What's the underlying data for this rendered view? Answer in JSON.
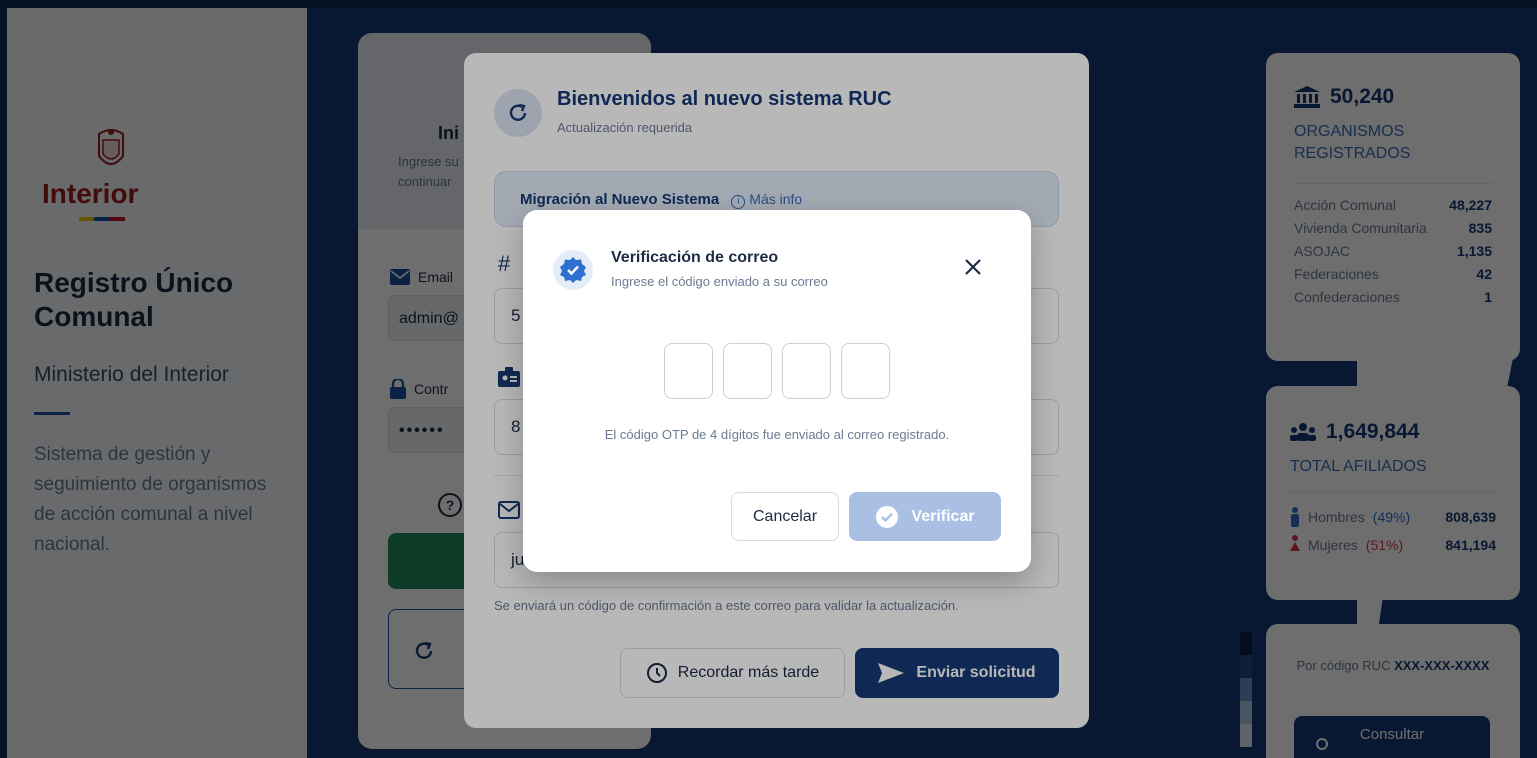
{
  "brand": {
    "name": "Interior",
    "flag_colors": [
      "#f2c200",
      "#1c4ea0",
      "#c8102e"
    ]
  },
  "sidebar": {
    "title": "Registro Único Comunal",
    "subtitle": "Ministerio del Interior",
    "description": "Sistema de gestión y seguimiento de organismos de acción comunal a nivel nacional."
  },
  "login": {
    "heading": "Ini",
    "intro": "Ingrese su\ncontinuar",
    "email_label": "Email",
    "email_value": "admin@",
    "password_label": "Contr",
    "password_value": "••••••"
  },
  "modal": {
    "title": "Bienvenidos al nuevo sistema RUC",
    "subtitle": "Actualización requerida",
    "migration_label": "Migración al Nuevo Sistema",
    "more_info": "Más info",
    "field1_value": "5",
    "field2_value": "8",
    "email_value": "ju",
    "note": "Se enviará un código de confirmación a este correo para validar la actualización.",
    "later_label": "Recordar más tarde",
    "send_label": "Enviar solicitud"
  },
  "otp": {
    "title": "Verificación de correo",
    "subtitle": "Ingrese el código enviado a su correo",
    "digits": [
      "",
      "",
      "",
      ""
    ],
    "message": "El código OTP de 4 dígitos fue enviado al correo registrado.",
    "cancel_label": "Cancelar",
    "verify_label": "Verificar"
  },
  "stats": {
    "organismos_total": "50,240",
    "organismos_label": "ORGANISMOS REGISTRADOS",
    "rows": [
      {
        "name": "Acción Comunal",
        "value": "48,227"
      },
      {
        "name": "Vivienda Comunitaria",
        "value": "835"
      },
      {
        "name": "ASOJAC",
        "value": "1,135"
      },
      {
        "name": "Federaciones",
        "value": "42"
      },
      {
        "name": "Confederaciones",
        "value": "1"
      }
    ],
    "afiliados_total": "1,649,844",
    "afiliados_label": "TOTAL AFILIADOS",
    "hombres_label": "Hombres",
    "hombres_pct": "(49%)",
    "hombres_value": "808,639",
    "mujeres_label": "Mujeres",
    "mujeres_pct": "(51%)",
    "mujeres_value": "841,194"
  },
  "ruc": {
    "prefix": "Por código RUC",
    "code": "XXX-XXX-XXXX",
    "button": "Consultar"
  },
  "colors": {
    "primary": "#173a75",
    "verify_disabled": "#a9c0e4",
    "male": "#2f6fcf",
    "female": "#d9344a",
    "legend_bars": [
      "#0b2047",
      "#1c4a8a",
      "#5f93c6",
      "#a6c5e2",
      "#d7e4f2"
    ]
  }
}
